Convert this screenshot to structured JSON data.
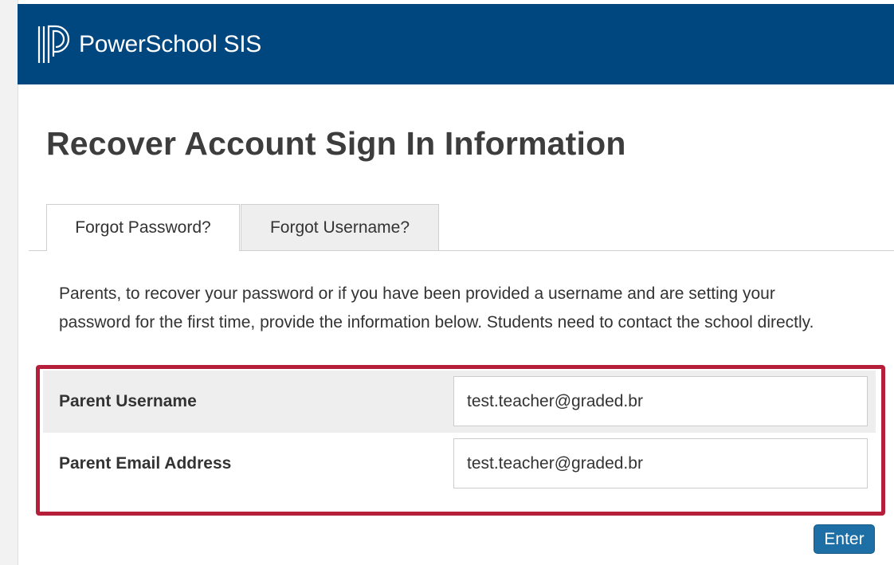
{
  "header": {
    "brand_name": "PowerSchool SIS",
    "logo_icon": "powerschool-p-icon",
    "background_color": "#00467f"
  },
  "page": {
    "title": "Recover Account Sign In Information"
  },
  "tabs": [
    {
      "label": "Forgot Password?",
      "active": true
    },
    {
      "label": "Forgot Username?",
      "active": false
    }
  ],
  "intro": {
    "text": "Parents, to recover your password or if you have been provided a username and are setting your password for the first time, provide the information below. Students need to contact the school directly."
  },
  "form": {
    "highlight_color": "#b51f39",
    "fields": [
      {
        "label": "Parent Username",
        "value": "test.teacher@graded.br"
      },
      {
        "label": "Parent Email Address",
        "value": "test.teacher@graded.br"
      }
    ]
  },
  "actions": {
    "enter_label": "Enter",
    "button_color": "#1d6fa5"
  }
}
